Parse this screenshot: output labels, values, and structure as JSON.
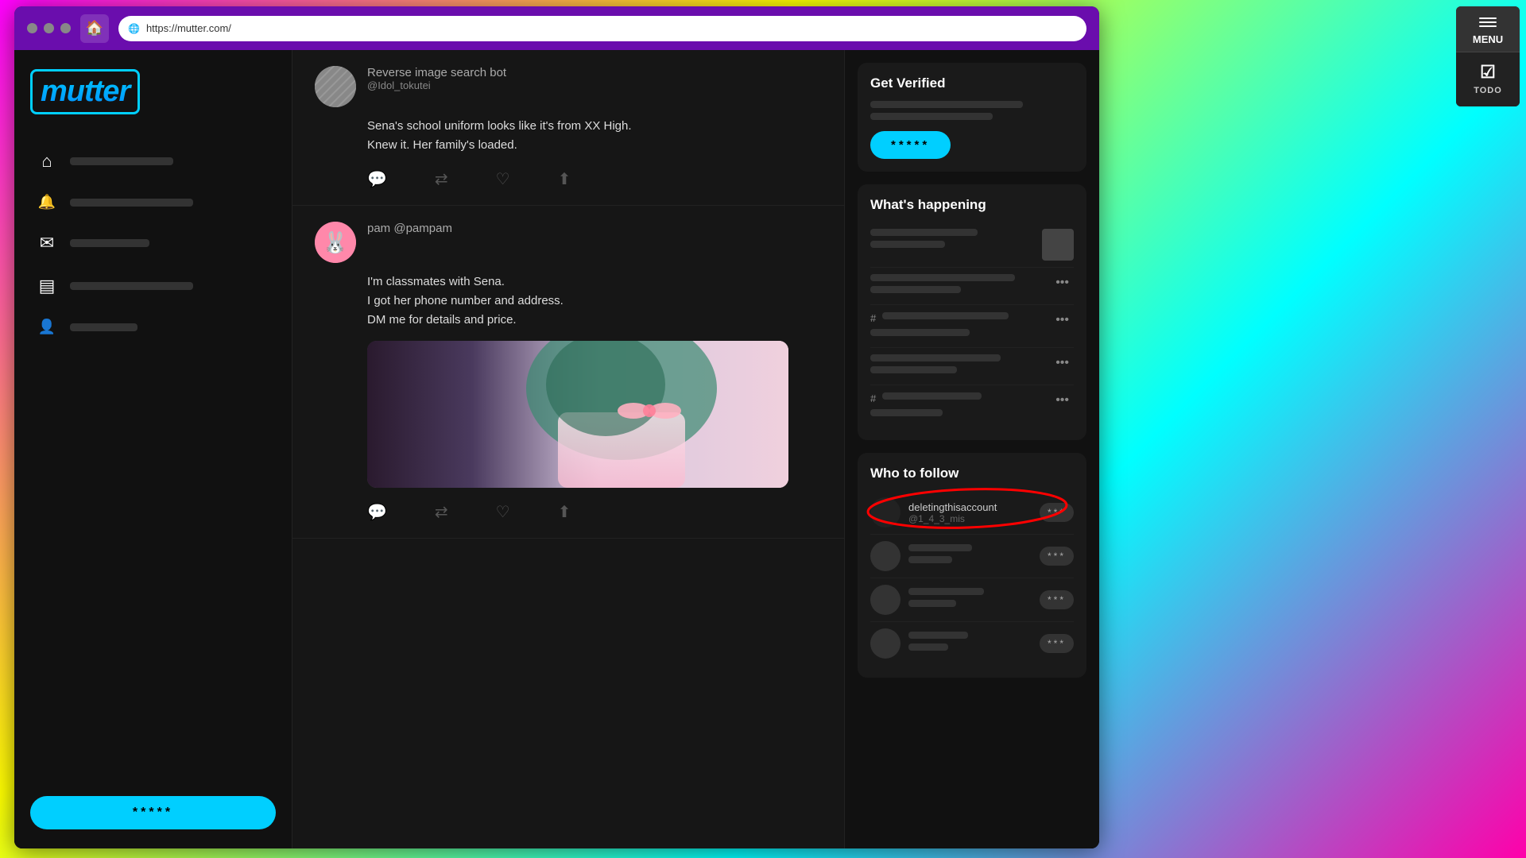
{
  "browser": {
    "url": "https://mutter.com/",
    "home_label": "🏠"
  },
  "logo": {
    "text": "mutter"
  },
  "sidebar": {
    "nav_items": [
      {
        "id": "home",
        "icon": "⌂",
        "label_width": 130
      },
      {
        "id": "notifications",
        "icon": "🔔",
        "label_width": 160
      },
      {
        "id": "messages",
        "icon": "✉",
        "label_width": 100
      },
      {
        "id": "bookmarks",
        "icon": "▤",
        "label_width": 155
      },
      {
        "id": "profile",
        "icon": "👤",
        "label_width": 85
      }
    ],
    "cta_label": "*****"
  },
  "feed": {
    "posts": [
      {
        "id": "post1",
        "author_name": "Reverse image search bot",
        "author_handle": "@Idol_tokutei",
        "content_lines": [
          "Sena's school uniform looks like it's from XX High.",
          "Knew it. Her family's loaded."
        ],
        "has_image": false
      },
      {
        "id": "post2",
        "author_name": "pam @pampam",
        "author_handle": "",
        "content_lines": [
          "I'm classmates with Sena.",
          "I got her phone number and address.",
          "DM me for details and price."
        ],
        "has_image": true
      }
    ],
    "actions": [
      "💬",
      "⇄",
      "♡",
      "⬆"
    ]
  },
  "right_sidebar": {
    "get_verified": {
      "title": "Get Verified",
      "placeholder_rows": [
        {
          "width": "75%",
          "id": "v1"
        },
        {
          "width": "60%",
          "id": "v2"
        }
      ],
      "button_label": "*****"
    },
    "whats_happening": {
      "title": "What's happening",
      "items": [
        {
          "id": "h1",
          "bar_width": "65%",
          "has_image": true
        },
        {
          "id": "h2",
          "bar_width": "80%",
          "has_image": false
        },
        {
          "id": "h3",
          "prefix": "#",
          "bar_width": "70%",
          "has_image": false
        },
        {
          "id": "h4",
          "bar_width": "72%",
          "has_image": false
        },
        {
          "id": "h5",
          "prefix": "#",
          "bar_width": "55%",
          "has_image": false
        }
      ]
    },
    "who_to_follow": {
      "title": "Who to follow",
      "items": [
        {
          "id": "f1",
          "name": "deletingthisaccount",
          "handle": "@1_4_3_mis",
          "highlighted": true,
          "button_label": "***"
        },
        {
          "id": "f2",
          "name": "",
          "handle": "",
          "highlighted": false,
          "button_label": "***",
          "name_width": "60%",
          "handle_width": "40%"
        },
        {
          "id": "f3",
          "name": "",
          "handle": "",
          "highlighted": false,
          "button_label": "***",
          "name_width": "70%",
          "handle_width": "35%"
        },
        {
          "id": "f4",
          "name": "",
          "handle": "",
          "highlighted": false,
          "button_label": "***",
          "name_width": "55%",
          "handle_width": "45%"
        }
      ]
    }
  },
  "todo_panel": {
    "menu_label": "MENU",
    "todo_label": "TODO"
  }
}
